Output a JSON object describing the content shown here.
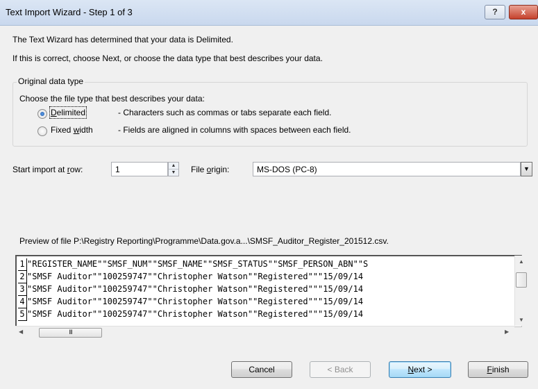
{
  "window": {
    "title": "Text Import Wizard - Step 1 of 3",
    "help_label": "?",
    "close_label": "x"
  },
  "intro": {
    "line1": "The Text Wizard has determined that your data is Delimited.",
    "line2": "If this is correct, choose Next, or choose the data type that best describes your data."
  },
  "original_data_type": {
    "legend": "Original data type",
    "prompt": "Choose the file type that best describes your data:",
    "options": [
      {
        "label_pre": "",
        "label_key": "D",
        "label_post": "elimited",
        "description": "- Characters such as commas or tabs separate each field.",
        "selected": true
      },
      {
        "label_pre": "Fixed ",
        "label_key": "w",
        "label_post": "idth",
        "description": "- Fields are aligned in columns with spaces between each field.",
        "selected": false
      }
    ]
  },
  "start_row": {
    "label_pre": "Start import at ",
    "label_key": "r",
    "label_post": "ow:",
    "value": "1"
  },
  "file_origin": {
    "label_pre": "File ",
    "label_key": "o",
    "label_post": "rigin:",
    "value": "MS-DOS (PC-8)"
  },
  "preview": {
    "caption": "Preview of file P:\\Registry Reporting\\Programme\\Data.gov.a...\\SMSF_Auditor_Register_201512.csv.",
    "rows": [
      {
        "num": "1",
        "text": "\"REGISTER_NAME\"\"SMSF_NUM\"\"SMSF_NAME\"\"SMSF_STATUS\"\"SMSF_PERSON_ABN\"\"S"
      },
      {
        "num": "2",
        "text": "\"SMSF Auditor\"\"100259747\"\"Christopher Watson\"\"Registered\"\"\"15/09/14"
      },
      {
        "num": "3",
        "text": "\"SMSF Auditor\"\"100259747\"\"Christopher Watson\"\"Registered\"\"\"15/09/14"
      },
      {
        "num": "4",
        "text": "\"SMSF Auditor\"\"100259747\"\"Christopher Watson\"\"Registered\"\"\"15/09/14"
      },
      {
        "num": "5",
        "text": "\"SMSF Auditor\"\"100259747\"\"Christopher Watson\"\"Registered\"\"\"15/09/14"
      }
    ],
    "hscroll_thumb_grip": "III"
  },
  "buttons": {
    "cancel": "Cancel",
    "back": "< Back",
    "next_key": "N",
    "next_post": "ext >",
    "finish_key": "F",
    "finish_post": "inish"
  }
}
